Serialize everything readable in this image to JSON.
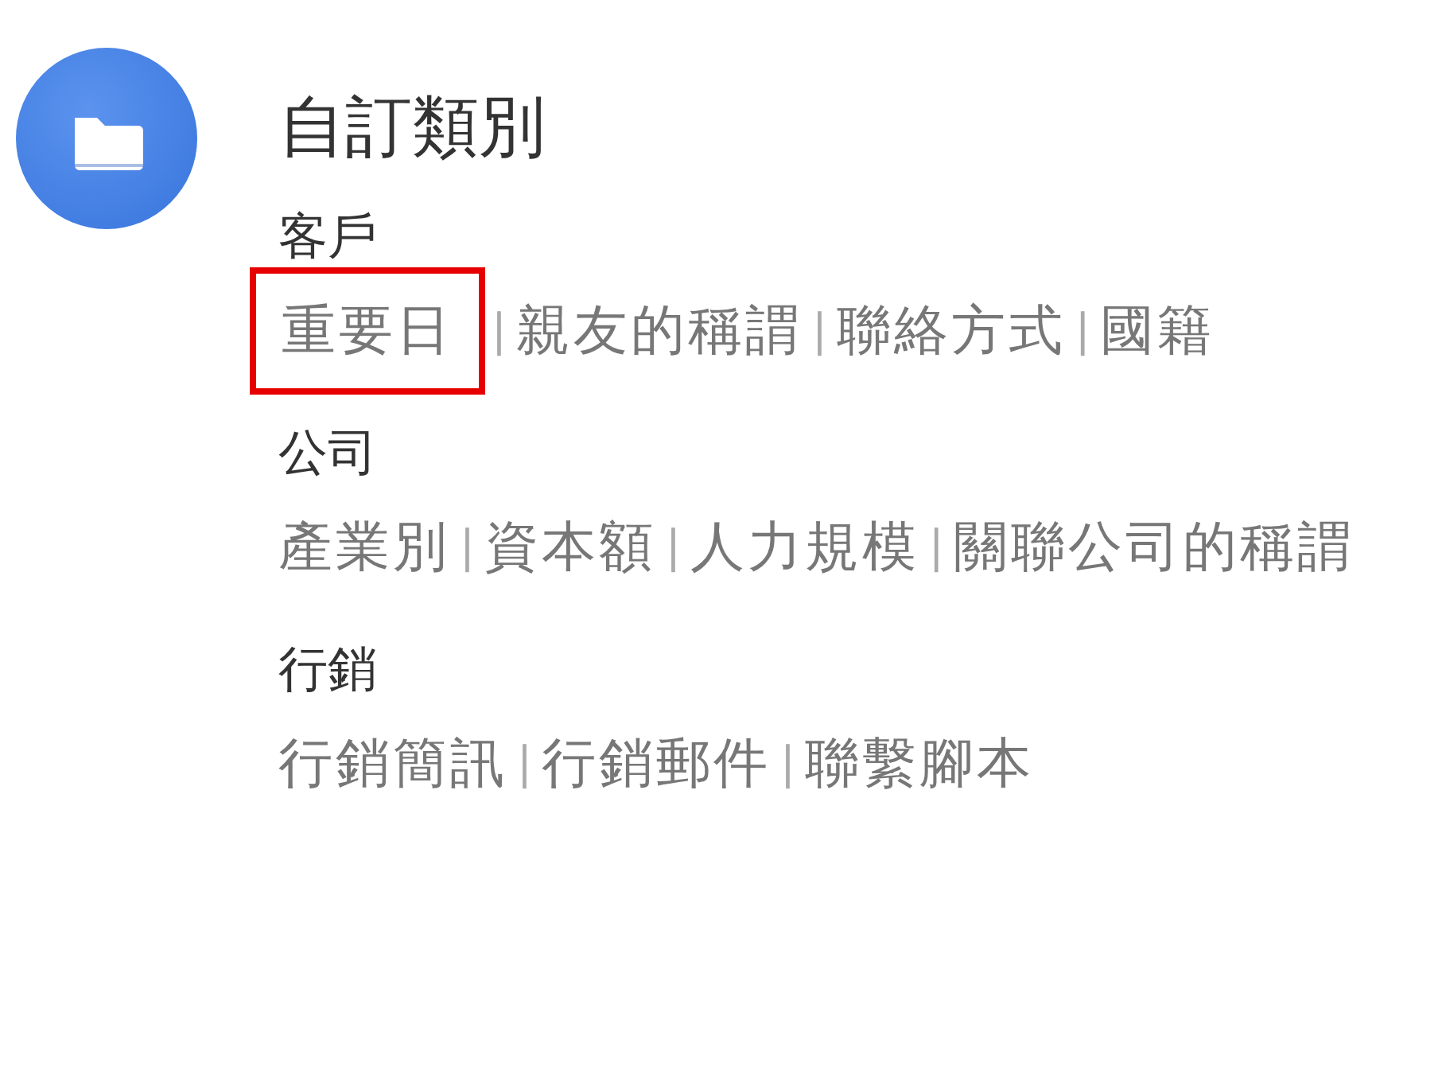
{
  "header": {
    "title": "自訂類別"
  },
  "groups": [
    {
      "label": "客戶",
      "items": [
        {
          "label": "重要日",
          "highlighted": true
        },
        {
          "separator": "|",
          "label": "親友的稱謂",
          "highlighted": false
        },
        {
          "separator": "|",
          "label": "聯絡方式",
          "highlighted": false
        },
        {
          "separator": "|",
          "label": "國籍",
          "highlighted": false
        }
      ]
    },
    {
      "label": "公司",
      "items": [
        {
          "label": "產業別",
          "highlighted": false
        },
        {
          "separator": "|",
          "label": "資本額",
          "highlighted": false
        },
        {
          "separator": "|",
          "label": "人力規模",
          "highlighted": false
        },
        {
          "separator": "|",
          "label": "關聯公司的稱謂",
          "highlighted": false
        }
      ]
    },
    {
      "label": "行銷",
      "items": [
        {
          "label": "行銷簡訊",
          "highlighted": false
        },
        {
          "separator": "|",
          "label": "行銷郵件",
          "highlighted": false
        },
        {
          "separator": "|",
          "label": "聯繫腳本",
          "highlighted": false
        }
      ]
    }
  ]
}
